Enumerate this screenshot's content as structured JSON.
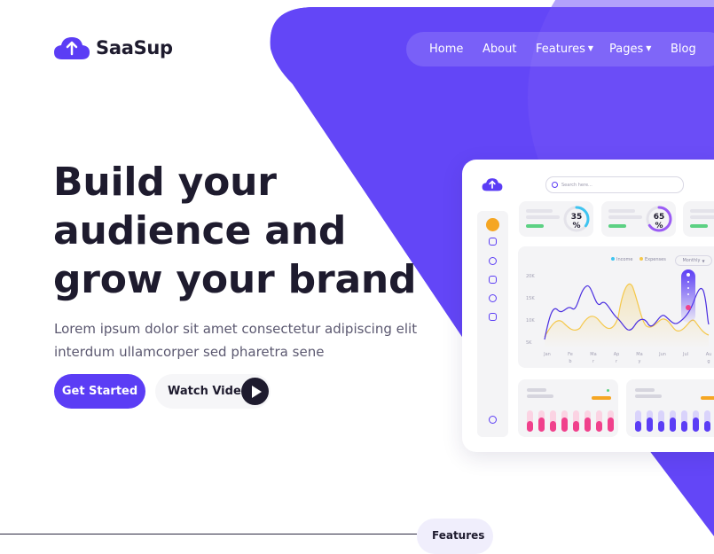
{
  "brand": {
    "name": "SaaSup"
  },
  "nav": {
    "items": [
      {
        "label": "Home"
      },
      {
        "label": "About"
      },
      {
        "label": "Features",
        "dropdown": true
      },
      {
        "label": "Pages",
        "dropdown": true
      },
      {
        "label": "Blog"
      }
    ]
  },
  "hero": {
    "title_lines": [
      "Build your",
      "audience and",
      "grow your brand"
    ],
    "text_lines": [
      "Lorem ipsum dolor sit amet consectetur adipiscing elit",
      "interdum ullamcorper sed pharetra sene"
    ],
    "primary_button": "Get Started",
    "secondary_button": "Watch Video"
  },
  "dashboard": {
    "search_placeholder": "Search here...",
    "stats": [
      {
        "value": "35",
        "unit": "%",
        "progress": 0.35,
        "color": "#3fc4f0"
      },
      {
        "value": "65",
        "unit": "%",
        "progress": 0.65,
        "color": "#9b5cf5"
      }
    ],
    "legend": {
      "income": "Income",
      "expenses": "Expenses",
      "period": "Monthly"
    },
    "yticks": [
      "20K",
      "15K",
      "10K",
      "5K"
    ],
    "months": [
      {
        "top": "Jan",
        "bottom": ""
      },
      {
        "top": "Fe",
        "bottom": "b"
      },
      {
        "top": "Ma",
        "bottom": "r"
      },
      {
        "top": "Ap",
        "bottom": "r"
      },
      {
        "top": "Ma",
        "bottom": "y"
      },
      {
        "top": "Jun",
        "bottom": ""
      },
      {
        "top": "Jul",
        "bottom": ""
      },
      {
        "top": "Au",
        "bottom": "g"
      }
    ],
    "colors": {
      "primary": "#5b3df5",
      "accent": "#f5a623",
      "pink": "#f0418c",
      "green": "#5cd183"
    }
  },
  "bottom_pill": {
    "label": "Features"
  }
}
